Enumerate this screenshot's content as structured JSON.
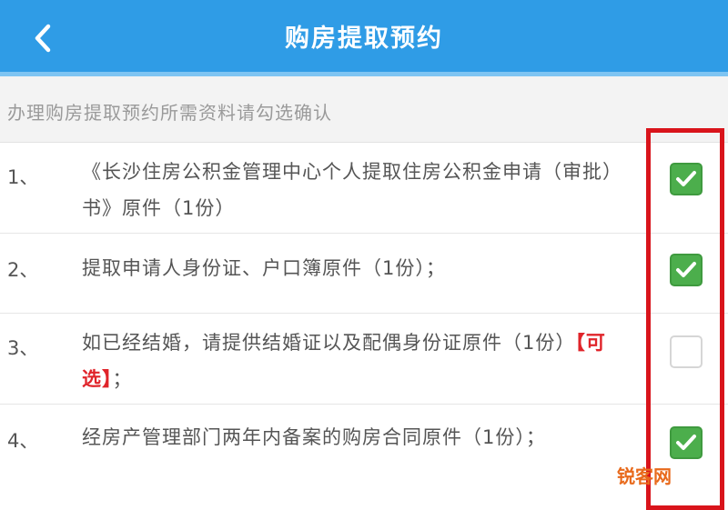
{
  "header": {
    "title": "购房提取预约",
    "back_icon": "chevron-left-icon"
  },
  "notice": "办理购房提取预约所需资料请勾选确认",
  "items": [
    {
      "num": "1、",
      "text": "《长沙住房公积金管理中心个人提取住房公积金申请（审批）书》原件（1份）",
      "checked": true
    },
    {
      "num": "2、",
      "text": "提取申请人身份证、户口簿原件（1份）；",
      "checked": true
    },
    {
      "num": "3、",
      "text": "如已经结婚，请提供结婚证以及配偶身份证原件（1份）",
      "optional": "【可选】",
      "suffix": "；",
      "checked": false
    },
    {
      "num": "4、",
      "text": "经房产管理部门两年内备案的购房合同原件（1份）；",
      "checked": true
    }
  ],
  "watermark": "锐客网",
  "colors": {
    "header": "#2f9ce6",
    "check_on": "#4cae4c",
    "highlight": "#d9141b",
    "optional_text": "#e0242a"
  }
}
